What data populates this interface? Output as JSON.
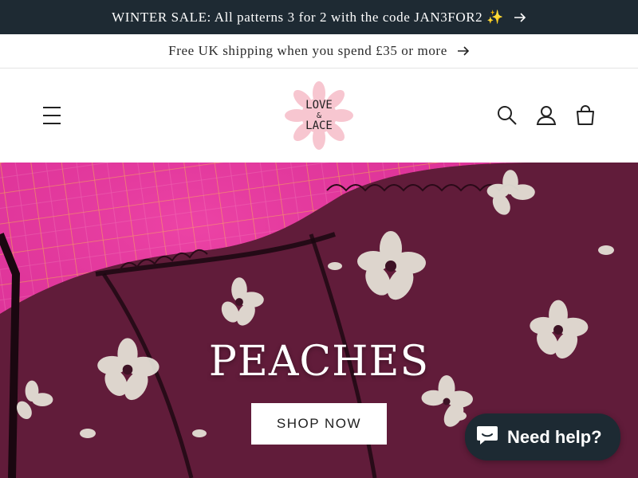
{
  "announcements": {
    "promo_text": "WINTER SALE: All patterns 3 for 2 with the code JAN3FOR2 ✨",
    "shipping_text": "Free UK shipping when you spend £35 or more"
  },
  "header": {
    "logo_line1": "LOVE",
    "logo_line2": "&",
    "logo_line3": "LACE",
    "icons": [
      "menu-icon",
      "search-icon",
      "account-icon",
      "cart-icon"
    ]
  },
  "hero": {
    "title": "PEACHES",
    "button_label": "SHOP NOW"
  },
  "chat": {
    "label": "Need help?",
    "icon": "chat-bubble-icon"
  },
  "colors": {
    "announcement_bg": "#1e2a33",
    "hero_pink": "#e0349a",
    "fabric_burgundy": "#5a1a34",
    "logo_petal": "#f7c6d0",
    "chat_bg": "#1d2a33"
  }
}
